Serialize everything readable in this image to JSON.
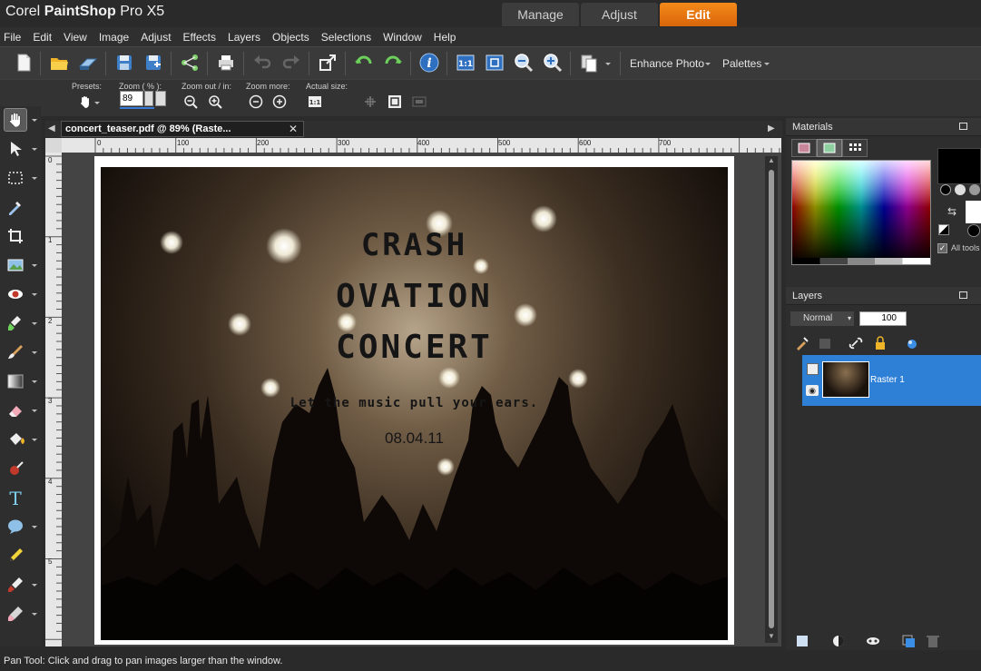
{
  "app": {
    "brand": "Corel",
    "product": "PaintShop",
    "version": "Pro X5"
  },
  "workspace_tabs": [
    {
      "label": "Manage"
    },
    {
      "label": "Adjust"
    },
    {
      "label": "Edit"
    }
  ],
  "menu": [
    "File",
    "Edit",
    "View",
    "Image",
    "Adjust",
    "Effects",
    "Layers",
    "Objects",
    "Selections",
    "Window",
    "Help"
  ],
  "toolbar": {
    "enhance_photo": "Enhance Photo",
    "palettes": "Palettes"
  },
  "tool_options": {
    "presets_label": "Presets:",
    "zoom_label": "Zoom ( % ):",
    "zoom_value": "89",
    "zoom_out_label": "Zoom out / in:",
    "zoom_more_label": "Zoom more:",
    "actual_size_label": "Actual size:"
  },
  "document": {
    "tab_title": "concert_teaser.pdf @  89% (Raste...",
    "ruler_h_ticks": [
      "0",
      "100",
      "200",
      "300",
      "400",
      "500",
      "600",
      "700"
    ],
    "ruler_v_ticks": [
      "0",
      "1",
      "2",
      "3",
      "4",
      "5"
    ]
  },
  "poster": {
    "line1": "CRASH",
    "line2": "OVATION",
    "line3": "CONCERT",
    "tagline": "Let the music pull your ears.",
    "date": "08.04.11"
  },
  "materials": {
    "title": "Materials",
    "all_tools_label": "All tools"
  },
  "layers": {
    "title": "Layers",
    "blend_mode": "Normal",
    "opacity": "100",
    "items": [
      {
        "name": "Raster 1"
      }
    ]
  },
  "status": {
    "text": "Pan Tool: Click and drag to pan images larger than the window."
  },
  "colors": {
    "accent": "#e8740f",
    "layer_selected": "#2e7fd6",
    "background": "#2b2b2b"
  }
}
